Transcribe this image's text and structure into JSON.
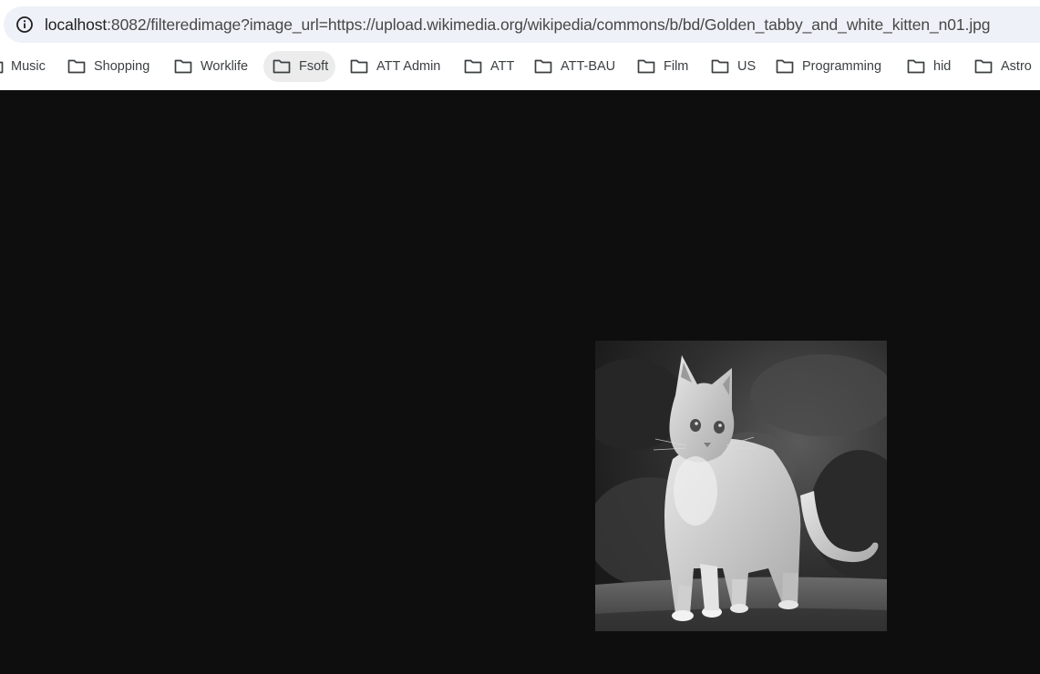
{
  "address_bar": {
    "host": "localhost",
    "rest": ":8082/filteredimage?image_url=https://upload.wikimedia.org/wikipedia/commons/b/bd/Golden_tabby_and_white_kitten_n01.jpg",
    "info_icon": "info-icon"
  },
  "bookmarks": [
    {
      "label": "Music",
      "icon": "folder-icon"
    },
    {
      "label": "Shopping",
      "icon": "folder-icon"
    },
    {
      "label": "Worklife",
      "icon": "folder-icon"
    },
    {
      "label": "Fsoft",
      "icon": "folder-icon",
      "active": true
    },
    {
      "label": "ATT Admin",
      "icon": "folder-icon"
    },
    {
      "label": "ATT",
      "icon": "folder-icon"
    },
    {
      "label": "ATT-BAU",
      "icon": "folder-icon"
    },
    {
      "label": "Film",
      "icon": "folder-icon"
    },
    {
      "label": "US",
      "icon": "folder-icon"
    },
    {
      "label": "Programming",
      "icon": "folder-icon"
    },
    {
      "label": "hid",
      "icon": "folder-icon"
    },
    {
      "label": "Astro",
      "icon": "folder-icon"
    }
  ],
  "content": {
    "image": {
      "description_icon": "kitten-photo",
      "filter": "grayscale"
    },
    "background_color": "#0e0e0e"
  }
}
